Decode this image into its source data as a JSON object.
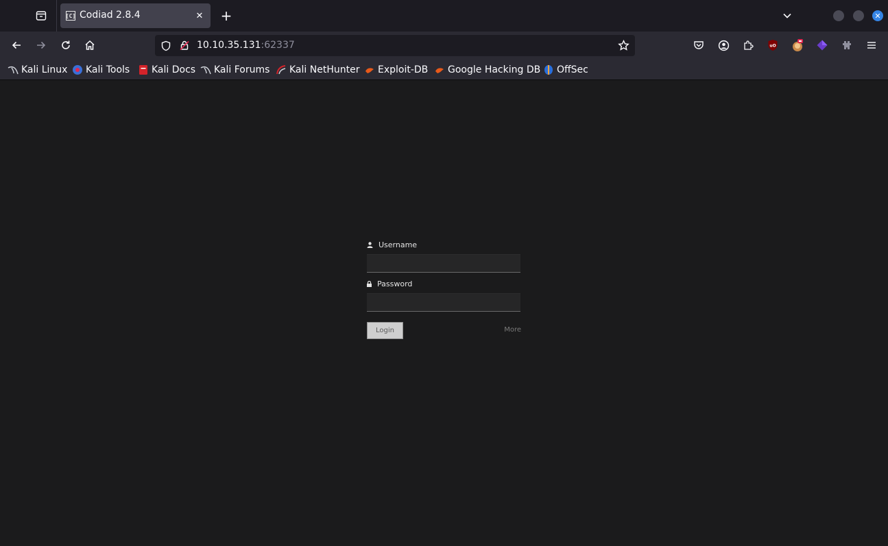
{
  "browser": {
    "tab": {
      "favicon_text": "[C]",
      "title": "Codiad 2.8.4",
      "close_glyph": "✕"
    },
    "new_tab_glyph": "+",
    "close_window_glyph": "✕",
    "url": {
      "host": "10.10.35.131",
      "port": ":62337"
    },
    "bookmarks": [
      {
        "label": "Kali Linux",
        "icon": "kali-dragon-icon"
      },
      {
        "label": "Kali Tools",
        "icon": "kali-tools-icon"
      },
      {
        "label": "Kali Docs",
        "icon": "kali-docs-icon"
      },
      {
        "label": "Kali Forums",
        "icon": "kali-dragon-icon"
      },
      {
        "label": "Kali NetHunter",
        "icon": "nethunter-icon"
      },
      {
        "label": "Exploit-DB",
        "icon": "exploit-db-icon"
      },
      {
        "label": "Google Hacking DB",
        "icon": "exploit-db-icon"
      },
      {
        "label": "OffSec",
        "icon": "offsec-icon"
      }
    ],
    "extensions": [
      "pocket-icon",
      "account-icon",
      "extensions-icon",
      "ublock-icon",
      "hackbar-icon",
      "purple-cube-icon",
      "puzzle-icon",
      "menu-icon"
    ]
  },
  "login": {
    "username_label": "Username",
    "password_label": "Password",
    "username_value": "",
    "password_value": "",
    "login_button": "Login",
    "more_link": "More"
  }
}
